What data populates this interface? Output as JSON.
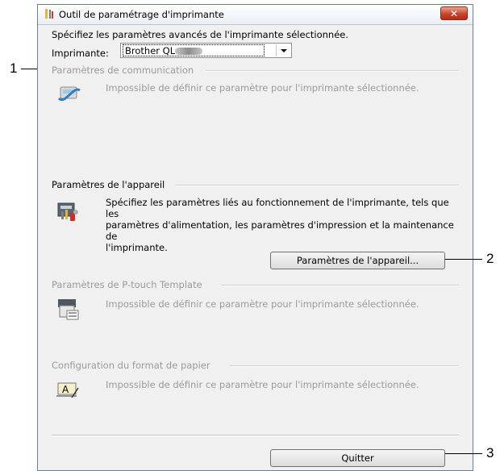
{
  "window": {
    "title": "Outil de paramétrage d'imprimante",
    "close_label": "✕",
    "subtitle": "Spécifiez les paramètres avancés de l'imprimante sélectionnée."
  },
  "printer": {
    "label": "Imprimante:",
    "selected": "Brother QL-"
  },
  "sections": {
    "communication": {
      "header": "Paramètres de communication",
      "description": "Impossible de définir ce paramètre pour l'imprimante sélectionnée."
    },
    "device": {
      "header": "Paramètres de l'appareil",
      "description_lines": [
        "Spécifiez les paramètres liés au fonctionnement de l'imprimante, tels que les",
        "paramètres d'alimentation, les paramètres d'impression et la maintenance de",
        "l'imprimante."
      ],
      "button_label": "Paramètres de l'appareil..."
    },
    "ptouch": {
      "header": "Paramètres de P-touch Template",
      "description": "Impossible de définir ce paramètre pour l'imprimante sélectionnée."
    },
    "paper": {
      "header": "Configuration du format de papier",
      "description": "Impossible de définir ce paramètre pour l'imprimante sélectionnée."
    }
  },
  "quit_label": "Quitter",
  "callouts": [
    "1",
    "2",
    "3"
  ],
  "colors": {
    "disabled_text": "#9a9a9a",
    "dialog_bg": "#f0f0f0",
    "close_red": "#c9452d"
  }
}
